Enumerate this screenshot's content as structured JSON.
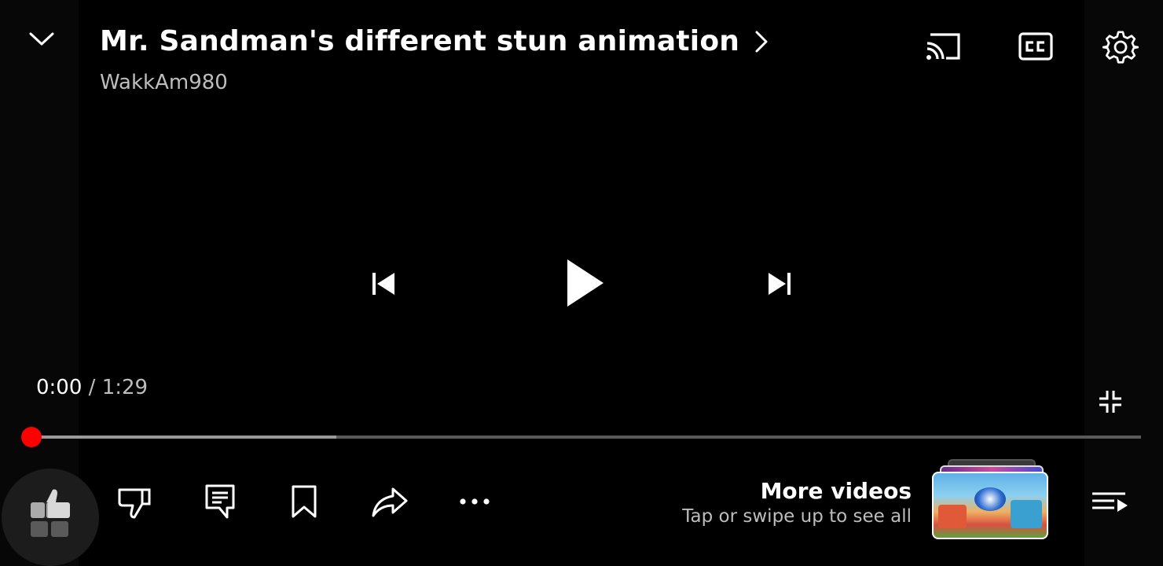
{
  "header": {
    "title": "Mr. Sandman's different stun animation",
    "channel": "WakkAm980"
  },
  "player": {
    "state": "paused",
    "time_current": "0:00",
    "time_separator": "/",
    "time_total": "1:29",
    "progress_fraction": 0.0,
    "buffered_fraction": 0.275,
    "accent_color": "#ff0000"
  },
  "actions": {
    "items": [
      "like",
      "dislike",
      "comments",
      "save",
      "share",
      "more"
    ]
  },
  "more_videos": {
    "title": "More videos",
    "subtitle": "Tap or swipe up to see all"
  },
  "icons": {
    "collapse": "chevron-down-icon",
    "title_more": "chevron-right-icon",
    "cast": "cast-icon",
    "captions": "closed-captions-icon",
    "settings": "gear-icon",
    "previous": "skip-previous-icon",
    "play": "play-icon",
    "next": "skip-next-icon",
    "exit_fullscreen": "exit-fullscreen-icon",
    "like": "thumbs-up-icon",
    "dislike": "thumbs-down-icon",
    "comments": "comment-icon",
    "save": "bookmark-icon",
    "share": "share-arrow-icon",
    "more": "more-horizontal-icon",
    "queue": "playlist-play-icon"
  }
}
